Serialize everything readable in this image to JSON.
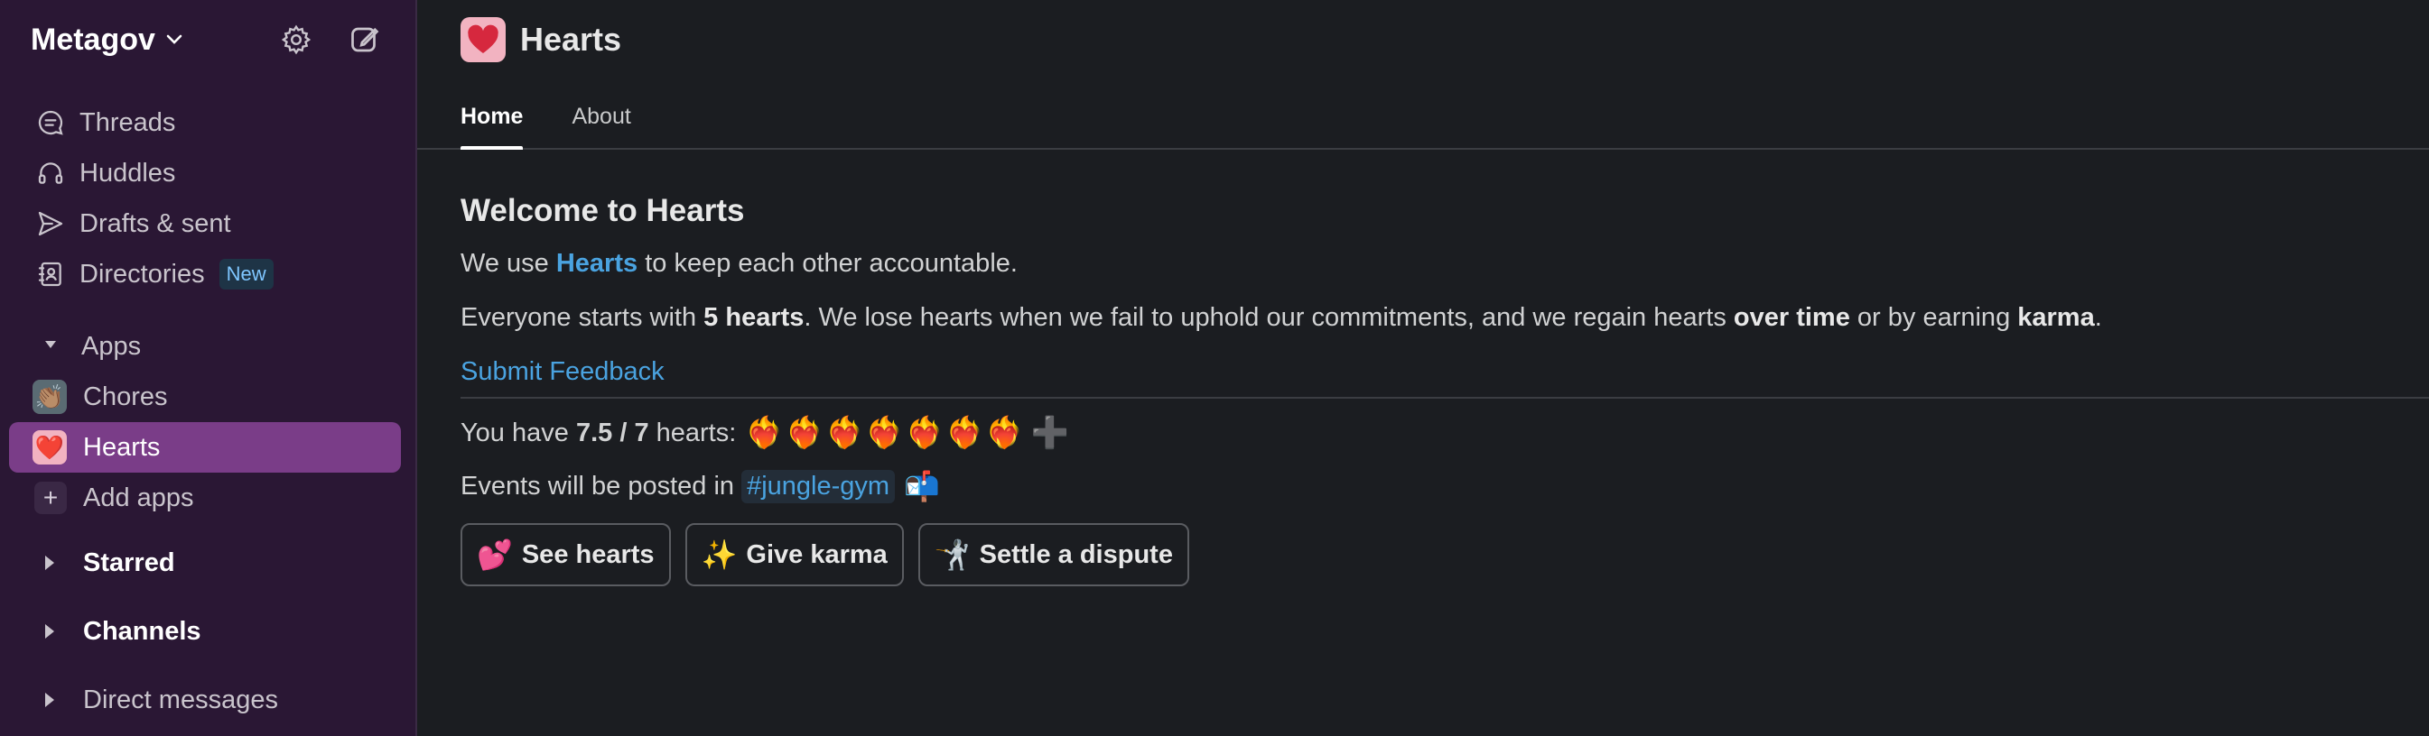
{
  "workspace": {
    "name": "Metagov"
  },
  "sidebar": {
    "nav": [
      {
        "label": "Threads",
        "icon": "threads-icon"
      },
      {
        "label": "Huddles",
        "icon": "headphones-icon"
      },
      {
        "label": "Drafts & sent",
        "icon": "send-icon"
      },
      {
        "label": "Directories",
        "icon": "directory-icon",
        "badge": "New"
      }
    ],
    "apps_label": "Apps",
    "apps": [
      {
        "label": "Chores",
        "icon": "👏🏽",
        "active": false
      },
      {
        "label": "Hearts",
        "icon": "❤️",
        "active": true
      }
    ],
    "add_apps": "Add apps",
    "starred": "Starred",
    "channels": "Channels",
    "direct_messages": "Direct messages"
  },
  "app": {
    "title": "Hearts",
    "tabs": [
      "Home",
      "About"
    ],
    "active_tab": "Home"
  },
  "content": {
    "welcome": "Welcome to Hearts",
    "p1_a": "We use",
    "p1_link": "Hearts",
    "p1_b": "to keep each other accountable.",
    "p2_a": "Everyone starts with",
    "p2_bold1": "5 hearts",
    "p2_b": ". We lose hearts when we fail to uphold our commitments, and we regain hearts",
    "p2_bold2": "over time",
    "p2_c": "or by earning",
    "p2_bold3": "karma",
    "p2_d": ".",
    "feedback_link": "Submit Feedback",
    "have_a": "You have",
    "have_count": "7.5 / 7",
    "have_b": "hearts:",
    "hearts_icons": [
      "❤️‍🔥",
      "❤️‍🔥",
      "❤️‍🔥",
      "❤️‍🔥",
      "❤️‍🔥",
      "❤️‍🔥",
      "❤️‍🔥"
    ],
    "hearts_extra": "➕",
    "events_a": "Events will be posted in",
    "events_channel": "#jungle-gym",
    "events_icon": "📬",
    "buttons": [
      {
        "emoji": "💕",
        "label": "See hearts"
      },
      {
        "emoji": "✨",
        "label": "Give karma"
      },
      {
        "emoji": "🤺",
        "label": "Settle a dispute"
      }
    ]
  },
  "colors": {
    "sidebar_bg": "#2a1734",
    "active_item": "#7a3d88",
    "main_bg": "#1b1d21",
    "link": "#4aa3e0"
  }
}
